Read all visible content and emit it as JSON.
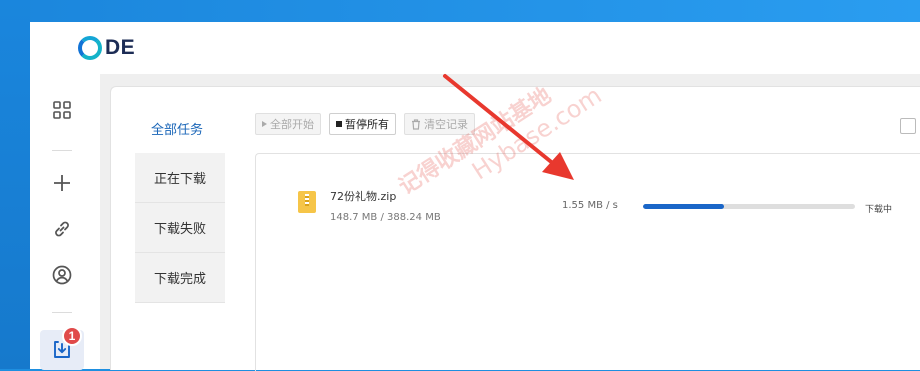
{
  "app": {
    "logo_text": "DE"
  },
  "sidebar": {
    "items": [
      {
        "name": "apps",
        "icon": "grid-icon"
      },
      {
        "name": "add",
        "icon": "plus-icon"
      },
      {
        "name": "link",
        "icon": "link-icon"
      },
      {
        "name": "account",
        "icon": "user-circle-icon"
      },
      {
        "name": "downloads",
        "icon": "download-icon",
        "badge": "1"
      }
    ]
  },
  "tabs": {
    "all": "全部任务",
    "items": [
      "正在下载",
      "下载失败",
      "下载完成"
    ]
  },
  "toolbar": {
    "start_all": "全部开始",
    "pause_all": "暂停所有",
    "clear": "清空记录"
  },
  "tasks": [
    {
      "name": "72份礼物.zip",
      "size": "148.7 MB / 388.24 MB",
      "speed": "1.55 MB / s",
      "progress": 0.383,
      "status": "下载中"
    }
  ],
  "watermark": {
    "cn": "记得收藏网站基地",
    "en": "Hybase.com"
  },
  "colors": {
    "accent": "#1a66c8",
    "badge": "#e04a4a",
    "arrow": "#e8382e"
  }
}
